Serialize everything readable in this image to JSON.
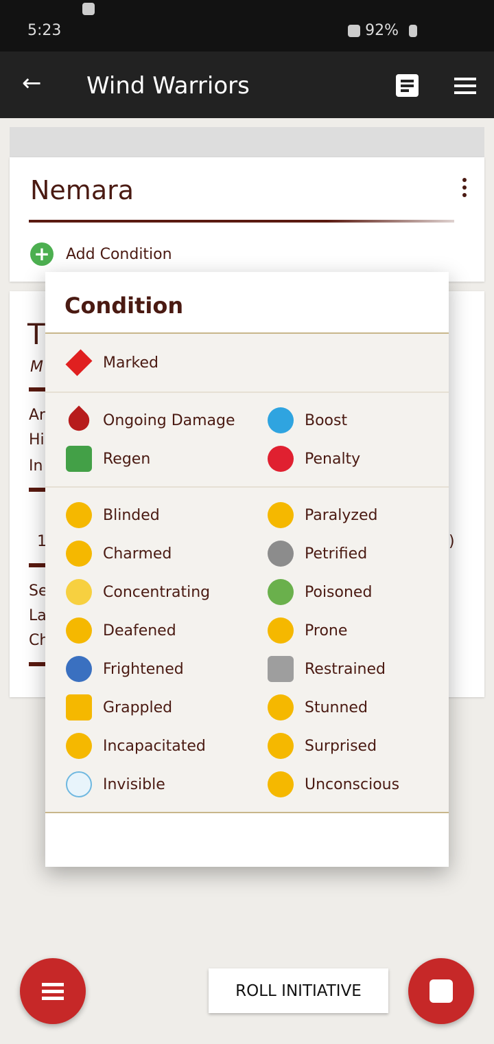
{
  "status": {
    "time": "5:23",
    "battery": "92%"
  },
  "appbar": {
    "title": "Wind Warriors",
    "back_icon": "arrow-left-icon",
    "notes_icon": "notes-icon",
    "menu_icon": "hamburger-icon"
  },
  "character": {
    "name": "Nemara",
    "add_condition": "Add Condition"
  },
  "background_fragments": [
    "T",
    "M",
    "Ar",
    "Hi",
    "In",
    "1",
    ")",
    "Se",
    "La",
    "Ch"
  ],
  "modal": {
    "title": "Condition",
    "sections": [
      [
        {
          "label": "Marked",
          "icon": "diamond-icon",
          "color": "#e02020"
        }
      ],
      [
        {
          "label": "Ongoing Damage",
          "icon": "blood-drop-icon",
          "color": "#b71c1c"
        },
        {
          "label": "Boost",
          "icon": "arrow-up-circle-icon",
          "color": "#2fa4e0"
        },
        {
          "label": "Regen",
          "icon": "bandage-icon",
          "color": "#43a047"
        },
        {
          "label": "Penalty",
          "icon": "arrow-down-circle-icon",
          "color": "#e02030"
        }
      ],
      [
        {
          "label": "Blinded",
          "icon": "eye-slash-icon",
          "color": "#f5b800"
        },
        {
          "label": "Paralyzed",
          "icon": "dizzy-face-icon",
          "color": "#f5b800"
        },
        {
          "label": "Charmed",
          "icon": "heart-eyes-icon",
          "color": "#f5b800"
        },
        {
          "label": "Petrified",
          "icon": "stone-face-icon",
          "color": "#8c8c8c"
        },
        {
          "label": "Concentrating",
          "icon": "lightbulb-icon",
          "color": "#f7d040"
        },
        {
          "label": "Poisoned",
          "icon": "nauseated-face-icon",
          "color": "#6ab04c"
        },
        {
          "label": "Deafened",
          "icon": "ear-slash-icon",
          "color": "#f5b800"
        },
        {
          "label": "Prone",
          "icon": "prone-face-icon",
          "color": "#f5b800"
        },
        {
          "label": "Frightened",
          "icon": "fearful-face-icon",
          "color": "#3a70c0"
        },
        {
          "label": "Restrained",
          "icon": "lock-icon",
          "color": "#9e9e9e"
        },
        {
          "label": "Grappled",
          "icon": "fist-icon",
          "color": "#f5b800"
        },
        {
          "label": "Stunned",
          "icon": "spiral-eyes-icon",
          "color": "#f5b800"
        },
        {
          "label": "Incapacitated",
          "icon": "runner-slash-icon",
          "color": "#f5b800"
        },
        {
          "label": "Surprised",
          "icon": "surprised-face-icon",
          "color": "#f5b800"
        },
        {
          "label": "Invisible",
          "icon": "ghost-face-icon",
          "color": "#e8f4fb"
        },
        {
          "label": "Unconscious",
          "icon": "sleepy-face-icon",
          "color": "#f5b800"
        }
      ]
    ]
  },
  "actions": {
    "roll_initiative": "ROLL INITIATIVE",
    "menu_fab_icon": "list-icon",
    "dice_fab_icon": "dice-icon",
    "accent": "#c62828"
  }
}
